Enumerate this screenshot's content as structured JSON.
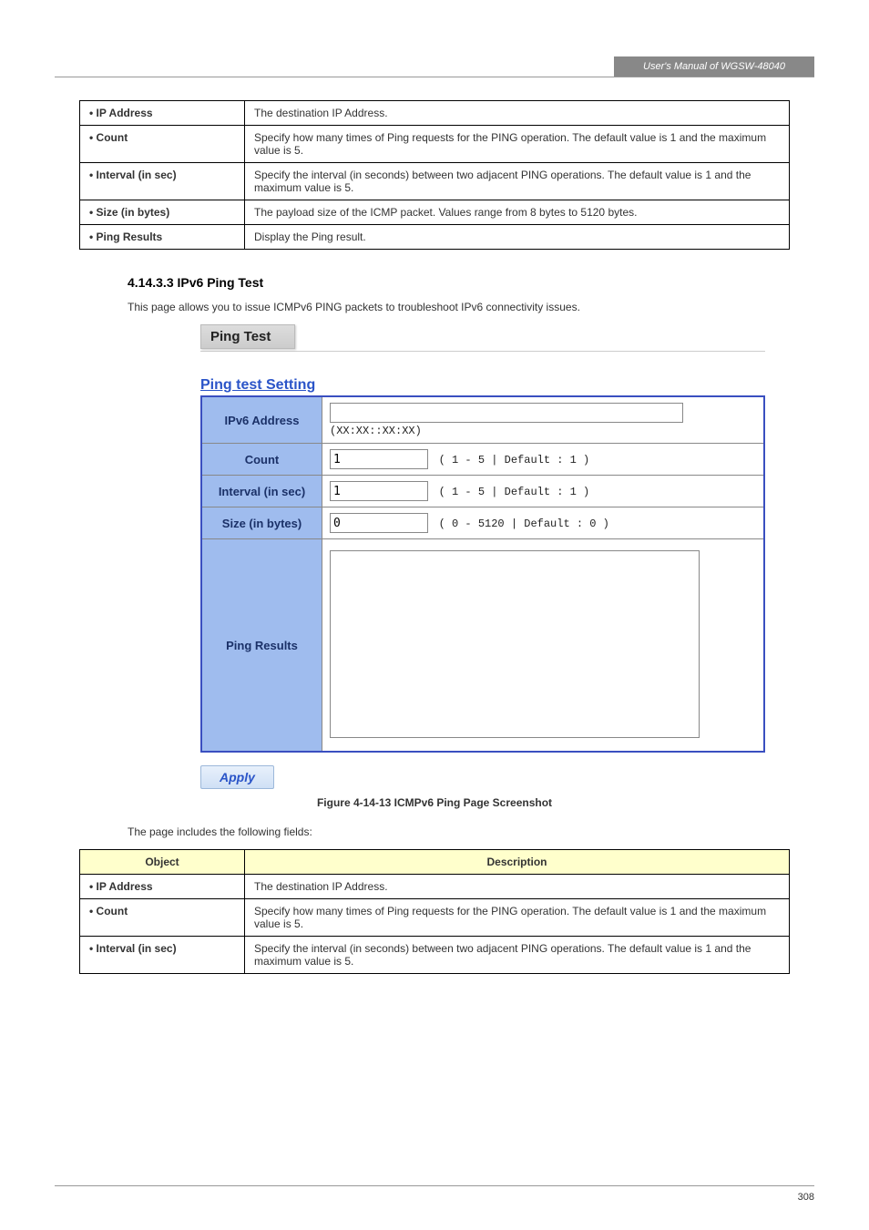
{
  "header": {
    "manual_title": "User's Manual of WGSW-48040",
    "page_number": "308"
  },
  "top_table": {
    "rows": [
      {
        "label": "IP Address",
        "desc": "The destination IP Address."
      },
      {
        "label": "Count",
        "desc": "Specify how many times of Ping requests for the PING operation. The default value is 1 and the maximum value is 5."
      },
      {
        "label": "Interval (in sec)",
        "desc": "Specify the interval (in seconds) between two adjacent PING operations. The default value is 1 and the maximum value is 5."
      },
      {
        "label": "Size (in bytes)",
        "desc": "The payload size of the ICMP packet. Values range from 8 bytes to 5120 bytes."
      },
      {
        "label": "Ping Results",
        "desc": "Display the Ping result."
      }
    ]
  },
  "section": {
    "number": "4.14.3.3",
    "title": "IPv6 Ping Test"
  },
  "intro": "This page allows you to issue ICMPv6 PING packets to troubleshoot IPv6 connectivity issues.",
  "figure": {
    "breadcrumb": "Ping Test",
    "panel_title": "Ping test Setting",
    "rows": {
      "ipv6": {
        "label": "IPv6 Address",
        "value": "",
        "hint": "(XX:XX::XX:XX)"
      },
      "count": {
        "label": "Count",
        "value": "1",
        "hint": "( 1 - 5 | Default : 1 )"
      },
      "interval": {
        "label": "Interval (in sec)",
        "value": "1",
        "hint": "( 1 - 5 | Default : 1 )"
      },
      "size": {
        "label": "Size (in bytes)",
        "value": "0",
        "hint": "( 0 - 5120 | Default : 0 )"
      },
      "results": {
        "label": "Ping Results",
        "value": ""
      }
    },
    "apply_label": "Apply",
    "caption": "Figure 4-14-13 ICMPv6 Ping Page Screenshot"
  },
  "desc_line": "The page includes the following fields:",
  "bottom_table": {
    "headers": {
      "object": "Object",
      "description": "Description"
    },
    "rows": [
      {
        "label": "IP Address",
        "desc": "The destination IP Address."
      },
      {
        "label": "Count",
        "desc": "Specify how many times of Ping requests for the PING operation. The default value is 1 and the maximum value is 5."
      },
      {
        "label": "Interval (in sec)",
        "desc": "Specify the interval (in seconds) between two adjacent PING operations. The default value is 1 and the maximum value is 5."
      }
    ]
  }
}
